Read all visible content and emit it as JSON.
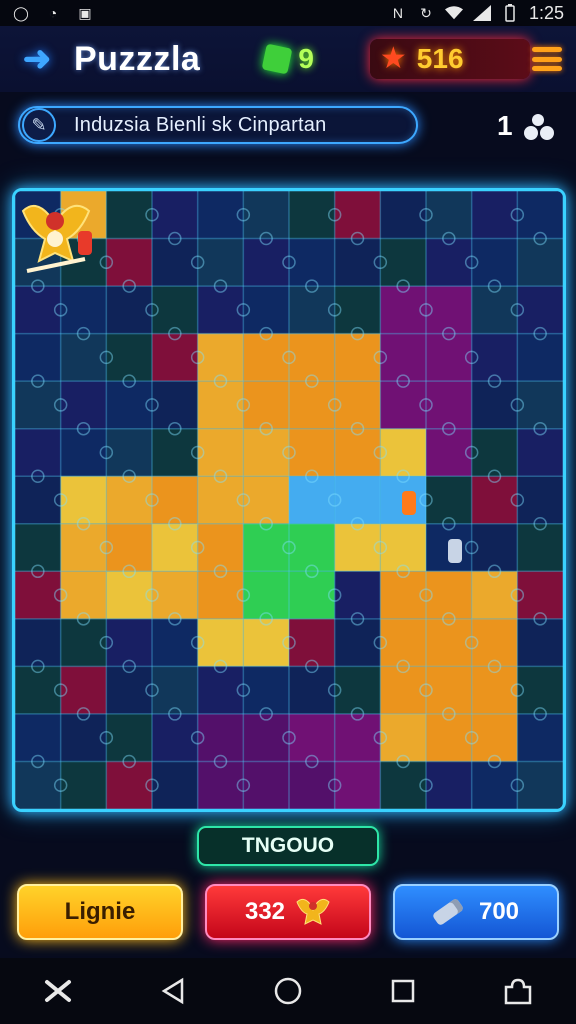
{
  "status_bar": {
    "time": "1:25",
    "left_icons": [
      "alarm-icon",
      "timer-icon",
      "image-icon"
    ],
    "right_icons": [
      "nfc-icon",
      "sync-icon",
      "wifi-icon",
      "signal-icon",
      "battery-icon"
    ]
  },
  "header": {
    "title": "Puzzzla",
    "gems": "9",
    "score": "516",
    "back_icon": "arrow-left-icon",
    "menu_icon": "hamburger-icon"
  },
  "info": {
    "text": "Induzsia Bienli sk Cinpartan",
    "level": "1"
  },
  "board": {
    "columns": 12,
    "rows": 13
  },
  "status_label": "TNGOUO",
  "buttons": {
    "yellow": "Lignie",
    "red": "332",
    "blue": "700"
  },
  "colors": {
    "accent_blue": "#3ad2ff",
    "gem_green": "#3fcf3a",
    "score_gold": "#ffcc30",
    "label_green": "#2ee6a8"
  }
}
